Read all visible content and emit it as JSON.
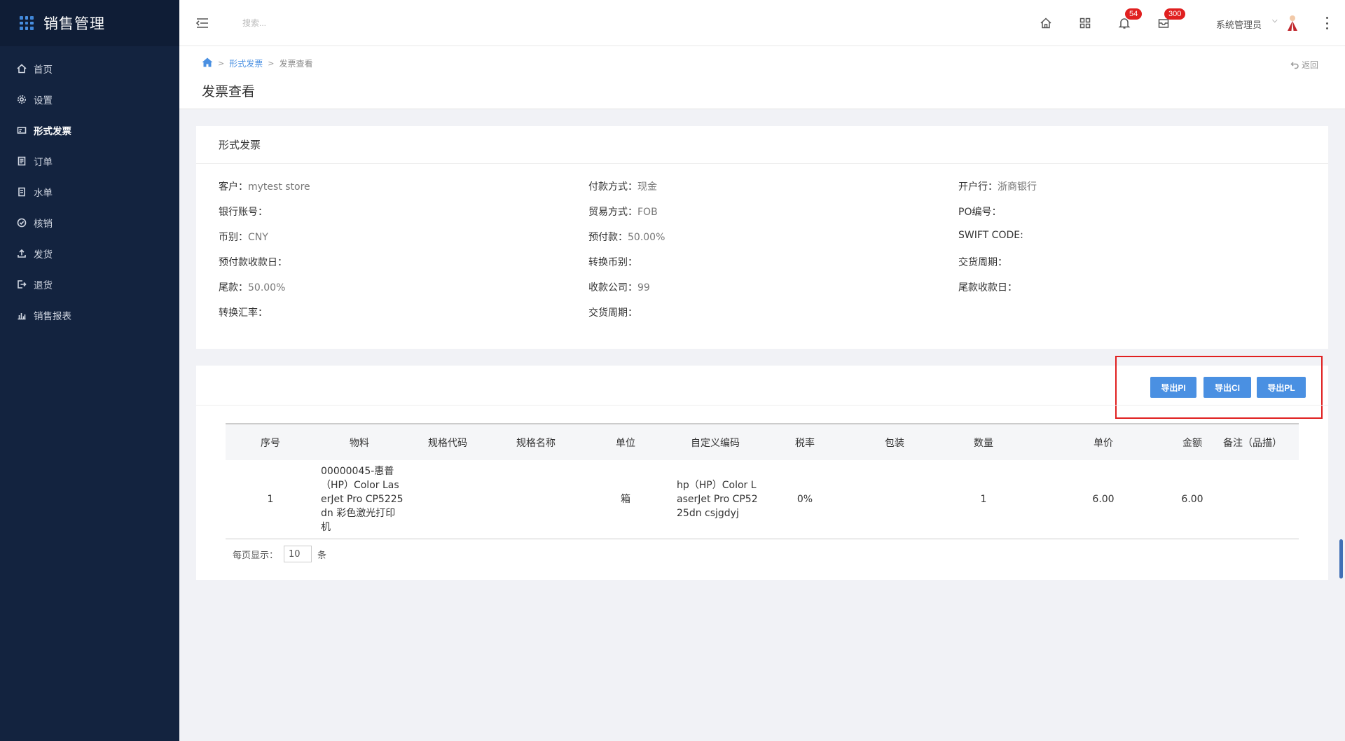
{
  "brand": {
    "title": "销售管理"
  },
  "sidebar": {
    "items": [
      {
        "label": "首页",
        "icon": "home-icon"
      },
      {
        "label": "设置",
        "icon": "gear-icon"
      },
      {
        "label": "形式发票",
        "icon": "invoice-icon",
        "active": true
      },
      {
        "label": "订单",
        "icon": "order-icon"
      },
      {
        "label": "水单",
        "icon": "receipt-icon"
      },
      {
        "label": "核销",
        "icon": "check-circle-icon"
      },
      {
        "label": "发货",
        "icon": "upload-icon"
      },
      {
        "label": "退货",
        "icon": "return-icon"
      },
      {
        "label": "销售报表",
        "icon": "bar-chart-icon"
      }
    ]
  },
  "header": {
    "search_placeholder": "搜索...",
    "notifications_badge": "54",
    "messages_badge": "300",
    "user_name": "系统管理员"
  },
  "breadcrumb": {
    "level1": "形式发票",
    "level2": "发票查看"
  },
  "page": {
    "title": "发票查看",
    "back_label": "返回"
  },
  "info_card": {
    "title": "形式发票",
    "fields": [
      {
        "label": "客户：",
        "value": "mytest store"
      },
      {
        "label": "付款方式：",
        "value": "现金"
      },
      {
        "label": "开户行：",
        "value": "浙商银行"
      },
      {
        "label": "银行账号：",
        "value": ""
      },
      {
        "label": "贸易方式：",
        "value": "FOB"
      },
      {
        "label": "PO编号：",
        "value": ""
      },
      {
        "label": "币别：",
        "value": "CNY"
      },
      {
        "label": "预付款：",
        "value": "50.00%"
      },
      {
        "label": "SWIFT CODE:",
        "value": ""
      },
      {
        "label": "预付款收款日：",
        "value": ""
      },
      {
        "label": "转换币别：",
        "value": ""
      },
      {
        "label": "交货周期：",
        "value": ""
      },
      {
        "label": "尾款：",
        "value": "50.00%"
      },
      {
        "label": "收款公司：",
        "value": "99"
      },
      {
        "label": "尾款收款日：",
        "value": ""
      },
      {
        "label": "转换汇率：",
        "value": ""
      },
      {
        "label": "交货周期：",
        "value": ""
      }
    ]
  },
  "buttons": {
    "export_pi": "导出PI",
    "export_ci": "导出CI",
    "export_pl": "导出PL"
  },
  "table": {
    "headers": [
      "序号",
      "物料",
      "规格代码",
      "规格名称",
      "单位",
      "自定义编码",
      "税率",
      "包装",
      "数量",
      "单价",
      "金额",
      "备注（品描）"
    ],
    "rows": [
      [
        "1",
        "00000045-惠普（HP）Color LaserJet Pro CP5225dn 彩色激光打印机",
        "",
        "",
        "箱",
        "hp（HP）Color LaserJet Pro CP5225dn csjgdyj",
        "0%",
        "",
        "1",
        "6.00",
        "6.00",
        ""
      ]
    ]
  },
  "pager": {
    "label": "每页显示：",
    "page_size": "10",
    "unit": "条"
  }
}
